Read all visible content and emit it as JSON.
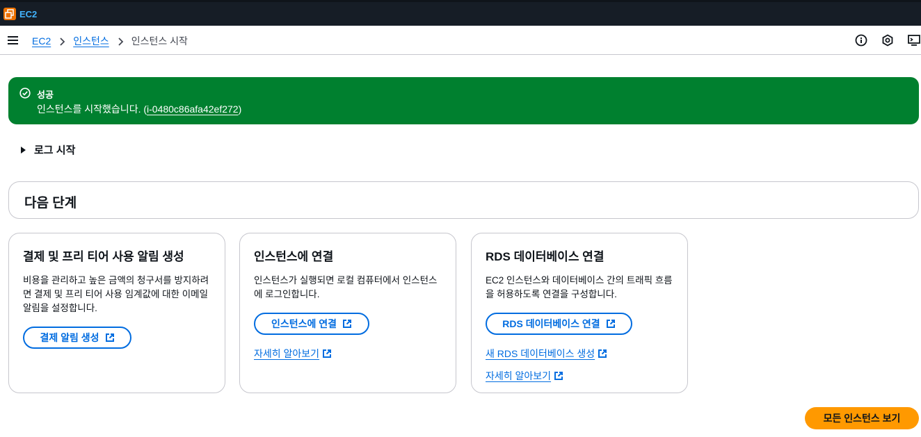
{
  "topbar": {
    "service_name": "EC2",
    "service_icon": "ec2-service-icon"
  },
  "breadcrumb": {
    "items": [
      "EC2",
      "인스턴스"
    ],
    "current": "인스턴스 시작"
  },
  "nav_icons": [
    "info-icon",
    "settings-hexagon-icon",
    "cloudshell-icon"
  ],
  "flash": {
    "title": "성공",
    "message_prefix": "인스턴스를 시작했습니다. (",
    "instance_id": "i-0480c86afa42ef272",
    "message_suffix": ")",
    "color": "#00802f"
  },
  "log": {
    "label": "로그 시작"
  },
  "next_steps": {
    "title": "다음 단계"
  },
  "cards": [
    {
      "title": "결제 및 프리 티어 사용 알림 생성",
      "desc": "비용을 관리하고 높은 금액의 청구서를 방지하려면 결제 및 프리 티어 사용 임계값에 대한 이메일 알림을 설정합니다.",
      "button": "결제 알림 생성"
    },
    {
      "title": "인스턴스에 연결",
      "desc": "인스턴스가 실행되면 로컬 컴퓨터에서 인스턴스에 로그인합니다.",
      "button": "인스턴스에 연결",
      "link1": "자세히 알아보기"
    },
    {
      "title": "RDS 데이터베이스 연결",
      "desc": "EC2 인스턴스와 데이터베이스 간의 트래픽 흐름을 허용하도록 연결을 구성합니다.",
      "button": "RDS 데이터베이스 연결",
      "link1": "새 RDS 데이터베이스 생성",
      "link2": "자세히 알아보기"
    }
  ],
  "primary_button": {
    "label": "모든 인스턴스 보기",
    "color": "#ff9900"
  },
  "colors": {
    "link": "#006ce0",
    "header_bg": "#161d26"
  }
}
